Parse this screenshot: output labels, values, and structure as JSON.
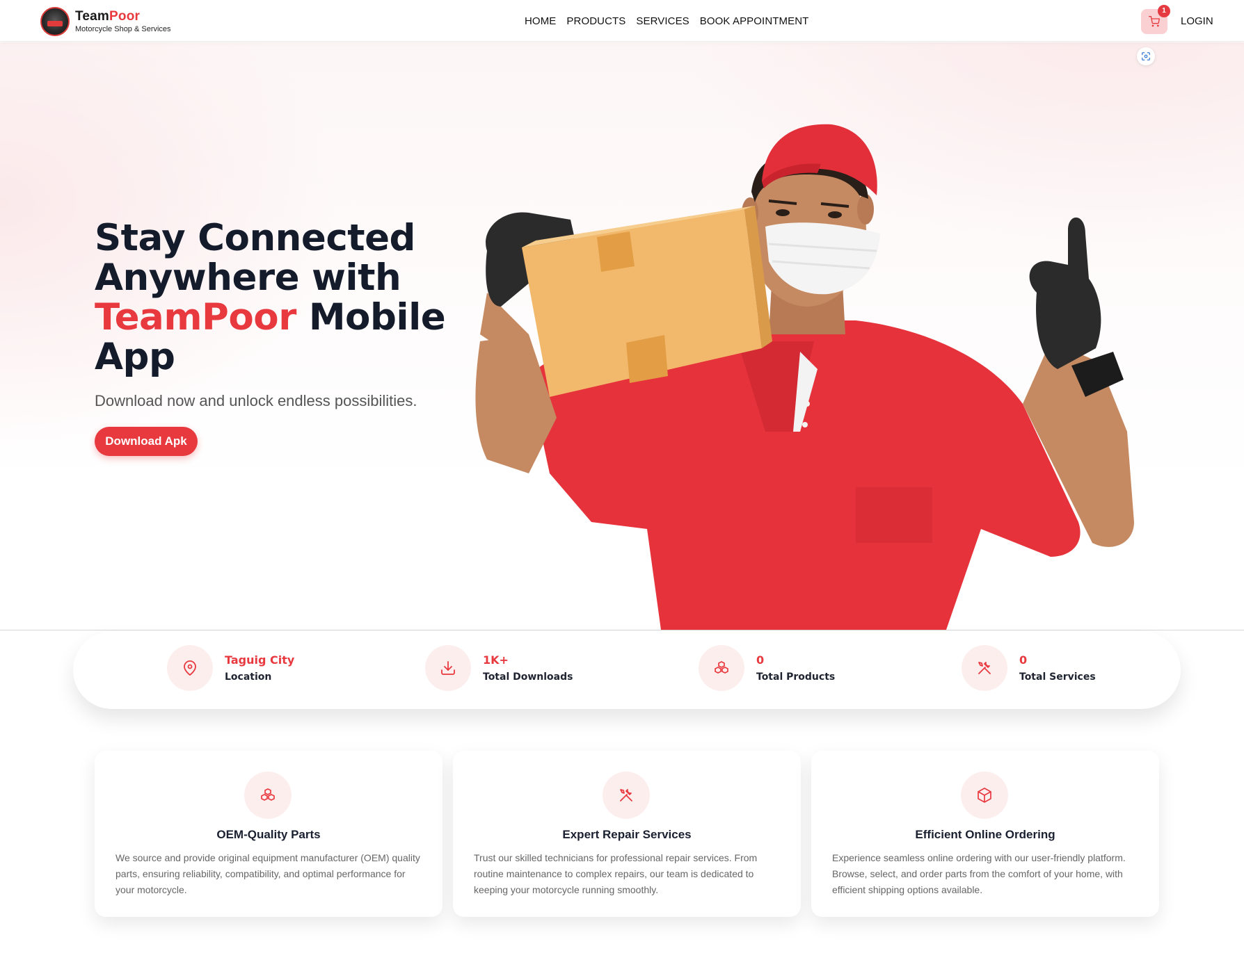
{
  "brand": {
    "name_part1": "Team",
    "name_part2": "Poor",
    "tagline": "Motorcycle Shop & Services"
  },
  "nav": {
    "items": [
      {
        "label": "HOME"
      },
      {
        "label": "PRODUCTS"
      },
      {
        "label": "SERVICES"
      },
      {
        "label": "BOOK APPOINTMENT"
      }
    ],
    "cart_count": "1",
    "login_label": "LOGIN"
  },
  "hero": {
    "title_line1": "Stay Connected Anywhere with",
    "title_accent": "TeamPoor",
    "title_line2": "Mobile App",
    "subtitle": "Download now and unlock endless possibilities.",
    "button_label": "Download Apk"
  },
  "stats": [
    {
      "icon": "location-pin-icon",
      "value": "Taguig City",
      "label": "Location"
    },
    {
      "icon": "download-icon",
      "value": "1K+",
      "label": "Total Downloads"
    },
    {
      "icon": "boxes-icon",
      "value": "0",
      "label": "Total Products"
    },
    {
      "icon": "tools-icon",
      "value": "0",
      "label": "Total Services"
    }
  ],
  "features": [
    {
      "icon": "boxes-icon",
      "title": "OEM-Quality Parts",
      "description": "We source and provide original equipment manufacturer (OEM) quality parts, ensuring reliability, compatibility, and optimal performance for your motorcycle."
    },
    {
      "icon": "tools-icon",
      "title": "Expert Repair Services",
      "description": "Trust our skilled technicians for professional repair services. From routine maintenance to complex repairs, our team is dedicated to keeping your motorcycle running smoothly."
    },
    {
      "icon": "package-icon",
      "title": "Efficient Online Ordering",
      "description": "Experience seamless online ordering with our user-friendly platform. Browse, select, and order parts from the comfort of your home, with efficient shipping options available."
    }
  ],
  "colors": {
    "accent": "#e8393f",
    "accent_soft": "#fdeeee",
    "text_dark": "#141b2b"
  }
}
